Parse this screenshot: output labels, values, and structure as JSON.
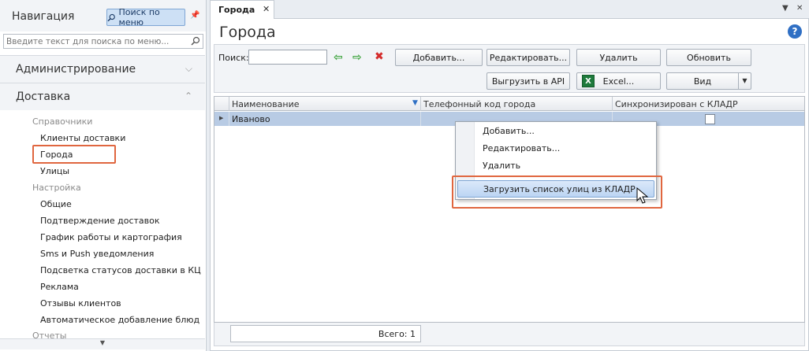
{
  "nav": {
    "title": "Навигация",
    "search_button": "Поиск по меню",
    "search_placeholder": "Введите текст для поиска по меню...",
    "sections": [
      {
        "label": "Администрирование"
      },
      {
        "label": "Доставка"
      }
    ],
    "groups": [
      {
        "label": "Справочники"
      },
      {
        "label": "Настройка"
      },
      {
        "label": "Отчеты"
      }
    ],
    "items": [
      {
        "label": "Клиенты доставки"
      },
      {
        "label": "Города"
      },
      {
        "label": "Улицы"
      },
      {
        "label": "Общие"
      },
      {
        "label": "Подтверждение доставок"
      },
      {
        "label": "График работы и картография"
      },
      {
        "label": "Sms и Push уведомления"
      },
      {
        "label": "Подсветка статусов доставки в КЦ"
      },
      {
        "label": "Реклама"
      },
      {
        "label": "Отзывы клиентов"
      },
      {
        "label": "Автоматическое добавление блюд"
      }
    ]
  },
  "tab": {
    "label": "Города",
    "close": "✕"
  },
  "page": {
    "title": "Города",
    "help": "?"
  },
  "toolbar": {
    "search_label": "Поиск:",
    "search_value": "",
    "add": "Добавить...",
    "edit": "Редактировать...",
    "delete": "Удалить",
    "refresh": "Обновить",
    "export_api": "Выгрузить в API",
    "excel": "Excel...",
    "view": "Вид"
  },
  "grid": {
    "columns": [
      "Наименование",
      "Телефонный код города",
      "Синхронизирован с КЛАДР"
    ],
    "rows": [
      {
        "name": "Иваново",
        "phone_code": "",
        "synced": false
      }
    ],
    "total": "Всего: 1"
  },
  "context_menu": {
    "items": [
      "Добавить...",
      "Редактировать...",
      "Удалить"
    ],
    "highlighted": "Загрузить список улиц из КЛАДР"
  },
  "colors": {
    "accent": "#e0663f",
    "selection": "#b8cbe4",
    "link_blue": "#2f6fc4"
  }
}
